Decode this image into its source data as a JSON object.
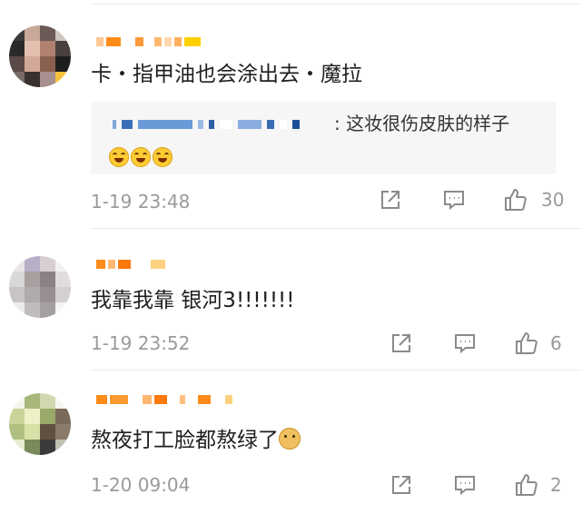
{
  "comments": [
    {
      "text": "卡・指甲油也会涂出去・魔拉",
      "reply": {
        "text": ": 这妆很伤皮肤的样子",
        "emojis": [
          "laugh-cry-emoji",
          "laugh-cry-emoji",
          "laugh-cry-emoji"
        ]
      },
      "time": "1-19 23:48",
      "likes": "30"
    },
    {
      "text": "我靠我靠 银河3!!!!!!!",
      "time": "1-19 23:52",
      "likes": "6"
    },
    {
      "text": "熬夜打工脸都熬绿了",
      "emoji": "doge-emoji",
      "time": "1-20 09:04",
      "likes": "2"
    }
  ],
  "colors": {
    "masked_name": "#ff8c1a",
    "masked_name_light": "#ffd27f",
    "time_gray": "#9a9a9a",
    "icon_gray": "#8a8a8a",
    "reply_bg": "#f6f6f6"
  }
}
